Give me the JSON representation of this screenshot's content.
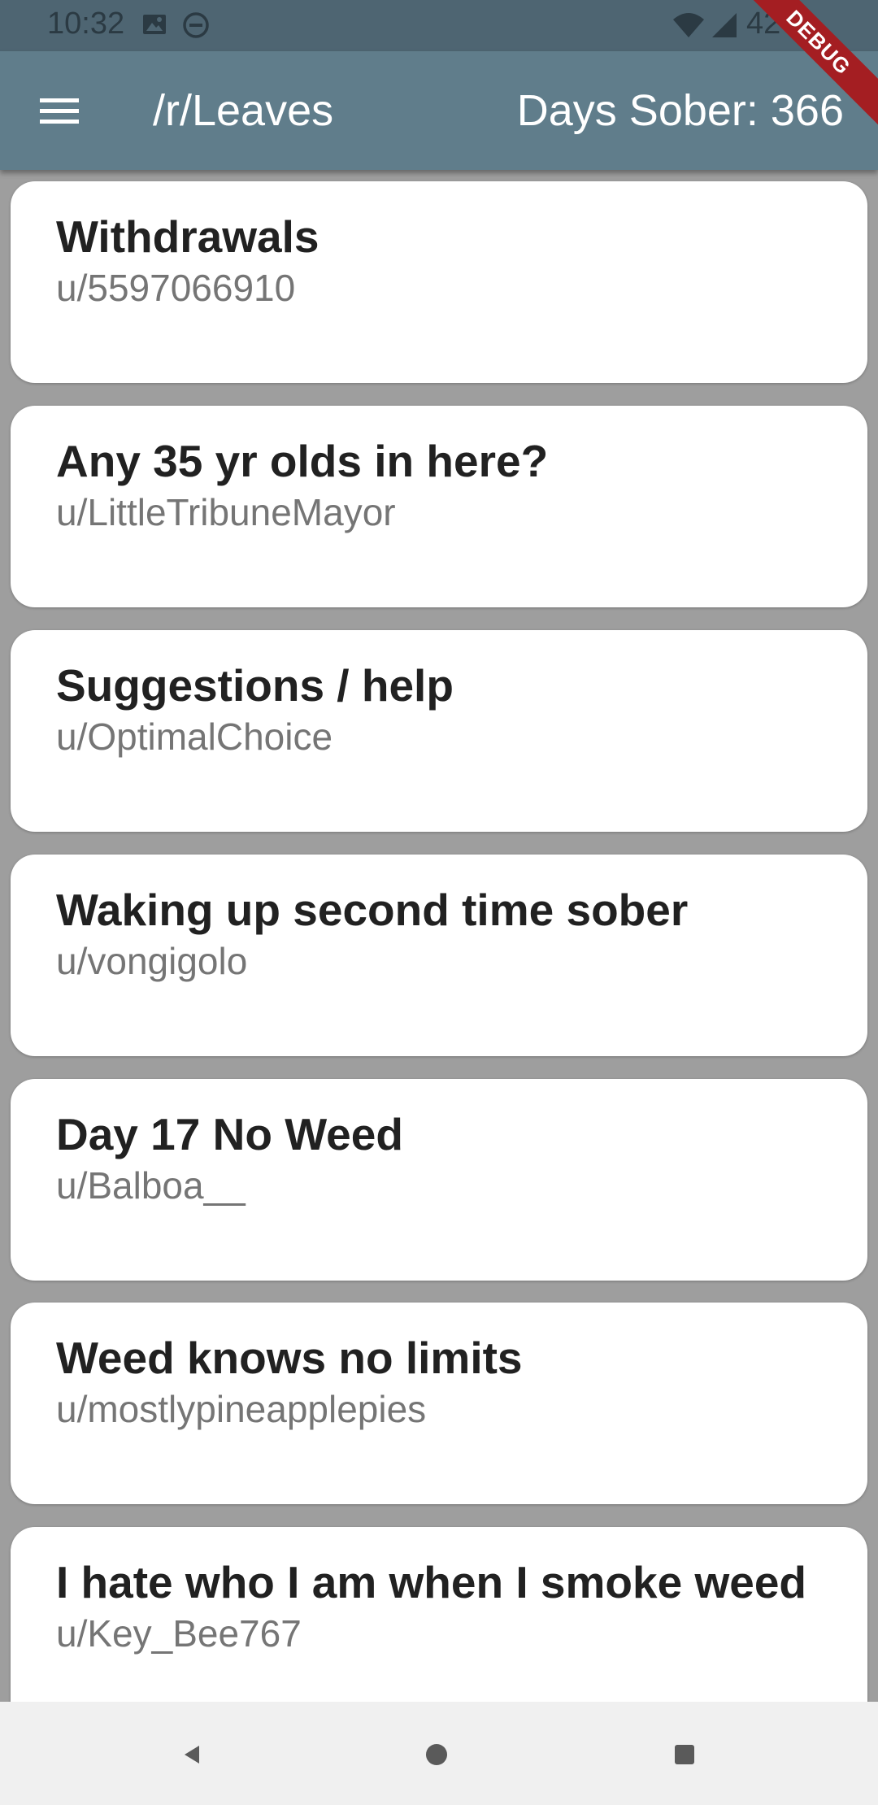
{
  "status_bar": {
    "time": "10:32",
    "battery": "42"
  },
  "app_bar": {
    "title": "/r/Leaves",
    "days_sober": "Days Sober: 366",
    "debug_banner": "DEBUG"
  },
  "posts": [
    {
      "title": "Withdrawals",
      "author": "u/5597066910"
    },
    {
      "title": "Any 35 yr olds in here?",
      "author": "u/LittleTribuneMayor"
    },
    {
      "title": "Suggestions / help",
      "author": "u/OptimalChoice"
    },
    {
      "title": "Waking up second time sober",
      "author": "u/vongigolo"
    },
    {
      "title": "Day 17 No Weed",
      "author": "u/Balboa__"
    },
    {
      "title": "Weed knows no limits",
      "author": "u/mostlypineapplepies"
    },
    {
      "title": "I hate who I am when I smoke weed",
      "author": "u/Key_Bee767"
    }
  ],
  "colors": {
    "app_bar": "#607d8b",
    "status_bar": "#4e6572",
    "background": "#9e9e9e",
    "card": "#ffffff",
    "debug_ribbon": "#a41e22"
  },
  "icons": {
    "menu": "hamburger-menu-icon",
    "status": [
      "image-icon",
      "do-not-disturb-icon",
      "wifi-icon",
      "signal-icon"
    ],
    "nav": [
      "back-icon",
      "home-icon",
      "recents-icon"
    ]
  }
}
